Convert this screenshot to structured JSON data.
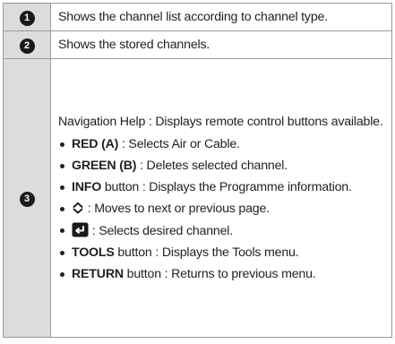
{
  "rows": [
    {
      "num": "1",
      "text": "Shows the channel list according to channel type."
    },
    {
      "num": "2",
      "text": "Shows the stored channels."
    },
    {
      "num": "3",
      "intro": "Navigation Help : Displays remote control buttons available.",
      "items": [
        {
          "key": "RED (A)",
          "text": " : Selects Air or Cable."
        },
        {
          "key": "GREEN (B)",
          "text": " : Deletes selected channel."
        },
        {
          "key": "INFO",
          "text": " button : Displays the Programme information."
        },
        {
          "icon": "up-down-arrows-icon",
          "text": " : Moves to next or previous page."
        },
        {
          "icon": "enter-button-icon",
          "text": " : Selects desired channel."
        },
        {
          "key": "TOOLS",
          "text": " button : Displays the Tools menu."
        },
        {
          "key": "RETURN",
          "text": " button : Returns to previous menu."
        }
      ]
    }
  ]
}
